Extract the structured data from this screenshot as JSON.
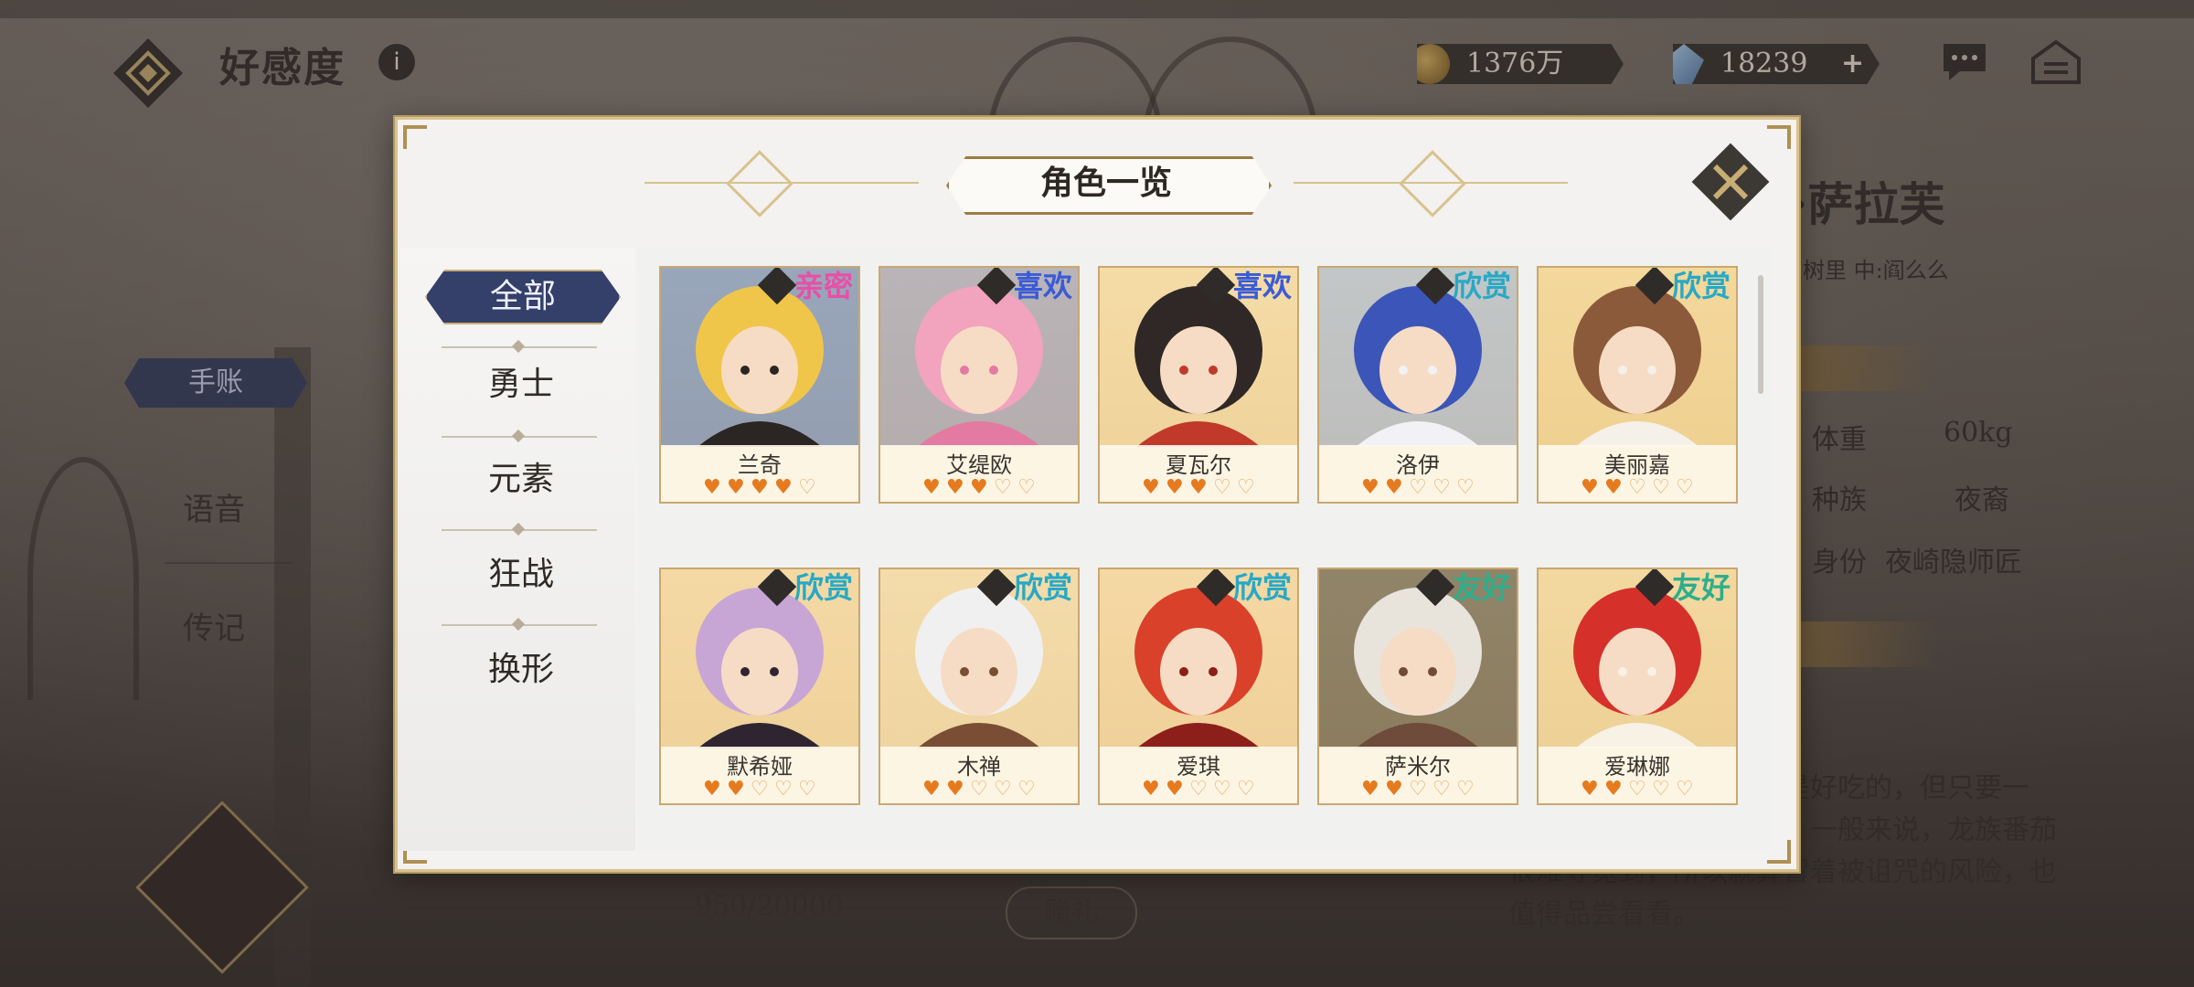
{
  "header": {
    "title": "好感度",
    "info_icon": "i"
  },
  "currency": {
    "gold": "1376万",
    "gems": "18239",
    "gems_plus": "+"
  },
  "side_menu": {
    "tag": "手账",
    "items": [
      "语音",
      "传记"
    ]
  },
  "right_panel": {
    "name": "·萨拉芙",
    "sub": "树里  中:阎么么",
    "rows": [
      {
        "label": "体重",
        "value": "60kg"
      },
      {
        "label": "种族",
        "value": "夜裔"
      },
      {
        "label": "身份",
        "value": "夜崎隐师匠"
      }
    ],
    "description": "吃上去有些偏硬，比较是好吃的，但只要一吃，就会中毒受到诅咒。一般来说，龙族番茄很难寻觅到，所以就算冒着被诅咒的风险，也值得品尝看看。"
  },
  "bottom": {
    "progress": "950/20000",
    "gift_button": "赠礼"
  },
  "modal": {
    "title": "角色一览",
    "tabs": [
      "全部",
      "勇士",
      "元素",
      "狂战",
      "换形"
    ],
    "active_tab": 0,
    "badge_colors": {
      "亲密": "#e84fa7",
      "喜欢": "#3a5bd8",
      "欣赏": "#27a9c6",
      "友好": "#2cae8c"
    },
    "cards": [
      {
        "name": "兰奇",
        "badge": "亲密",
        "hearts": [
          2,
          2,
          2,
          1,
          0
        ],
        "art": [
          "#f0c64a",
          "#2b2523",
          "#3b6fd0"
        ]
      },
      {
        "name": "艾缇欧",
        "badge": "喜欢",
        "hearts": [
          2,
          2,
          1,
          0,
          0
        ],
        "art": [
          "#f2a3bd",
          "#e27aa2",
          "#7d8cc9"
        ]
      },
      {
        "name": "夏瓦尔",
        "badge": "喜欢",
        "hearts": [
          2,
          2,
          1,
          0,
          0
        ],
        "art": [
          "#2f2826",
          "#c0392b",
          "#f3d9a6"
        ]
      },
      {
        "name": "洛伊",
        "badge": "欣赏",
        "hearts": [
          2,
          2,
          0,
          0,
          0
        ],
        "art": [
          "#3c55b8",
          "#f2f2f6",
          "#8fb0e8"
        ]
      },
      {
        "name": "美丽嘉",
        "badge": "欣赏",
        "hearts": [
          2,
          2,
          0,
          0,
          0
        ],
        "art": [
          "#8b5a3a",
          "#f5f0e8",
          "#f2d392"
        ]
      },
      {
        "name": "默希娅",
        "badge": "欣赏",
        "hearts": [
          2,
          2,
          0,
          0,
          0
        ],
        "art": [
          "#c7a6d6",
          "#2f2530",
          "#f3d6a4"
        ]
      },
      {
        "name": "木禅",
        "badge": "欣赏",
        "hearts": [
          2,
          2,
          0,
          0,
          0
        ],
        "art": [
          "#f0f0f0",
          "#7a4e34",
          "#f2dcb0"
        ]
      },
      {
        "name": "爱琪",
        "badge": "欣赏",
        "hearts": [
          2,
          2,
          0,
          0,
          0
        ],
        "art": [
          "#d9412a",
          "#8c1f1a",
          "#f4d3a2"
        ]
      },
      {
        "name": "萨米尔",
        "badge": "友好",
        "hearts": [
          2,
          1,
          0,
          0,
          0
        ],
        "art": [
          "#e8e4dc",
          "#6e4b3a",
          "#2b2b2b"
        ]
      },
      {
        "name": "爱琳娜",
        "badge": "友好",
        "hearts": [
          2,
          1,
          0,
          0,
          0
        ],
        "art": [
          "#d6302b",
          "#f7f1e6",
          "#f0d49a"
        ]
      }
    ]
  }
}
